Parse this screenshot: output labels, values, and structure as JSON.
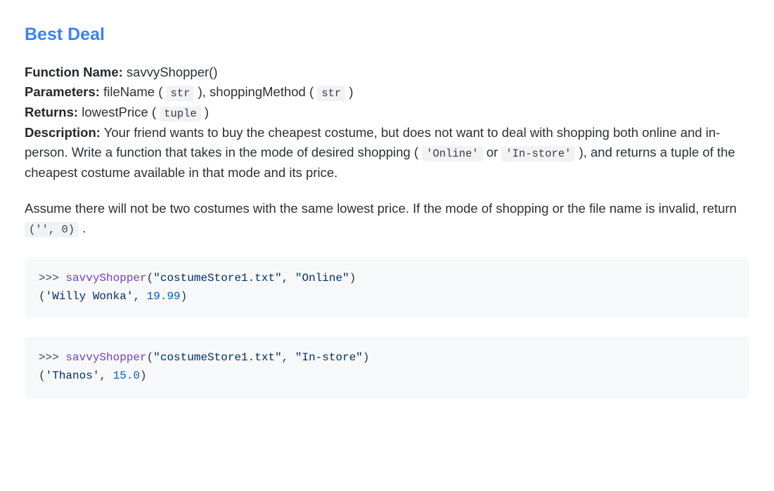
{
  "title": "Best Deal",
  "labels": {
    "function_name": "Function Name:",
    "parameters": "Parameters:",
    "returns": "Returns:",
    "description": "Description:"
  },
  "function_name": "savvyShopper()",
  "parameters": {
    "param1_name": "fileName",
    "param1_type": "str",
    "param2_name": "shoppingMethod",
    "param2_type": "str"
  },
  "returns": {
    "name": "lowestPrice",
    "type": "tuple"
  },
  "description": {
    "lead": "Your friend wants to buy the cheapest costume, but does not want to deal with shopping both online and in-person. Write a function that takes in the mode of desired shopping (",
    "opt1": "'Online'",
    "or_word": "or",
    "opt2": "'In-store'",
    "tail": "), and returns a tuple of the cheapest costume available in that mode and its price."
  },
  "assumption": {
    "lead": "Assume there will not be two costumes with the same lowest price. If the mode of shopping or the file name is invalid, return ",
    "retval": "('', 0)",
    "tail": "."
  },
  "examples": [
    {
      "prompt": ">>> ",
      "func": "savvyShopper",
      "lp": "(",
      "arg1": "\"costumeStore1.txt\"",
      "comma": ", ",
      "arg2": "\"Online\"",
      "rp": ")",
      "out_lp": "(",
      "out_str": "'Willy Wonka'",
      "out_comma": ", ",
      "out_num": "19.99",
      "out_rp": ")"
    },
    {
      "prompt": ">>> ",
      "func": "savvyShopper",
      "lp": "(",
      "arg1": "\"costumeStore1.txt\"",
      "comma": ", ",
      "arg2": "\"In-store\"",
      "rp": ")",
      "out_lp": "(",
      "out_str": "'Thanos'",
      "out_comma": ", ",
      "out_num": "15.0",
      "out_rp": ")"
    }
  ]
}
